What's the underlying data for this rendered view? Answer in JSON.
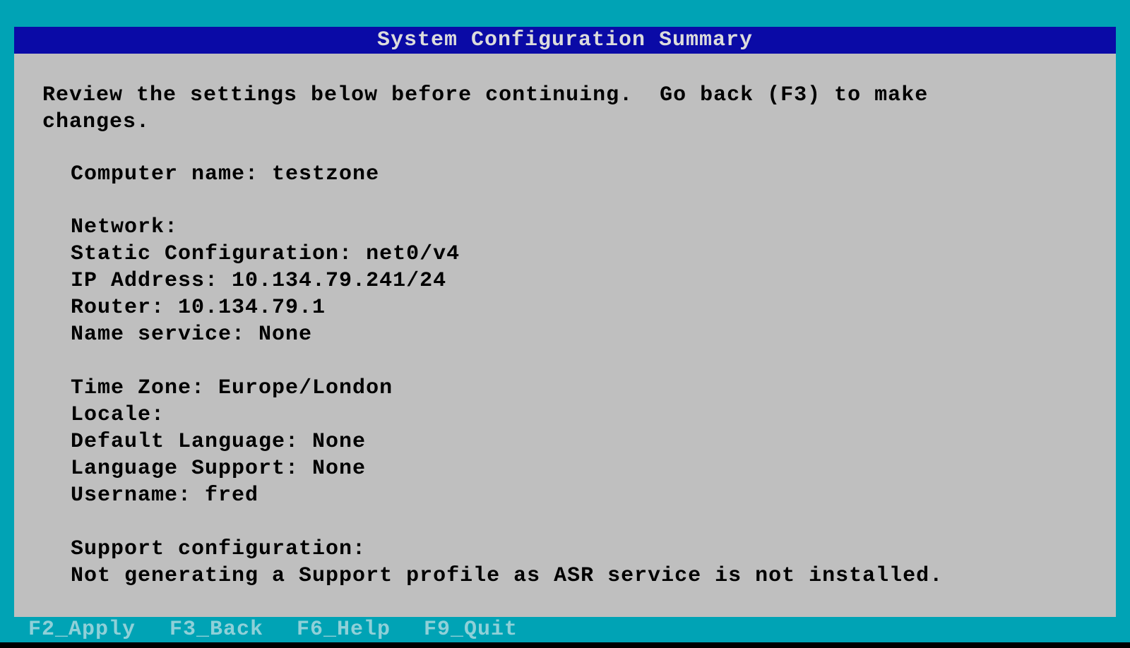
{
  "title": "System Configuration Summary",
  "intro": {
    "line1": "Review the settings below before continuing.  Go back (F3) to make",
    "line2": "changes."
  },
  "summary": {
    "computer_name": "Computer name: testzone",
    "network_header": "Network:",
    "static_config": "Static Configuration: net0/v4",
    "ip_address": "IP Address: 10.134.79.241/24",
    "router": "Router: 10.134.79.1",
    "name_service": "Name service: None",
    "time_zone": "Time Zone: Europe/London",
    "locale": "Locale:",
    "default_language": "Default Language: None",
    "language_support": "Language Support: None",
    "username": "Username: fred",
    "support_header": "Support configuration:",
    "support_note": "Not generating a Support profile as ASR service is not installed."
  },
  "footer": {
    "apply": "F2_Apply",
    "back": "F3_Back",
    "help": "F6_Help",
    "quit": "F9_Quit"
  },
  "colors": {
    "background": "#00a3b5",
    "title_bar": "#0a0aa6",
    "panel": "#bfbfbf",
    "footer_text": "#8fd0d8"
  }
}
